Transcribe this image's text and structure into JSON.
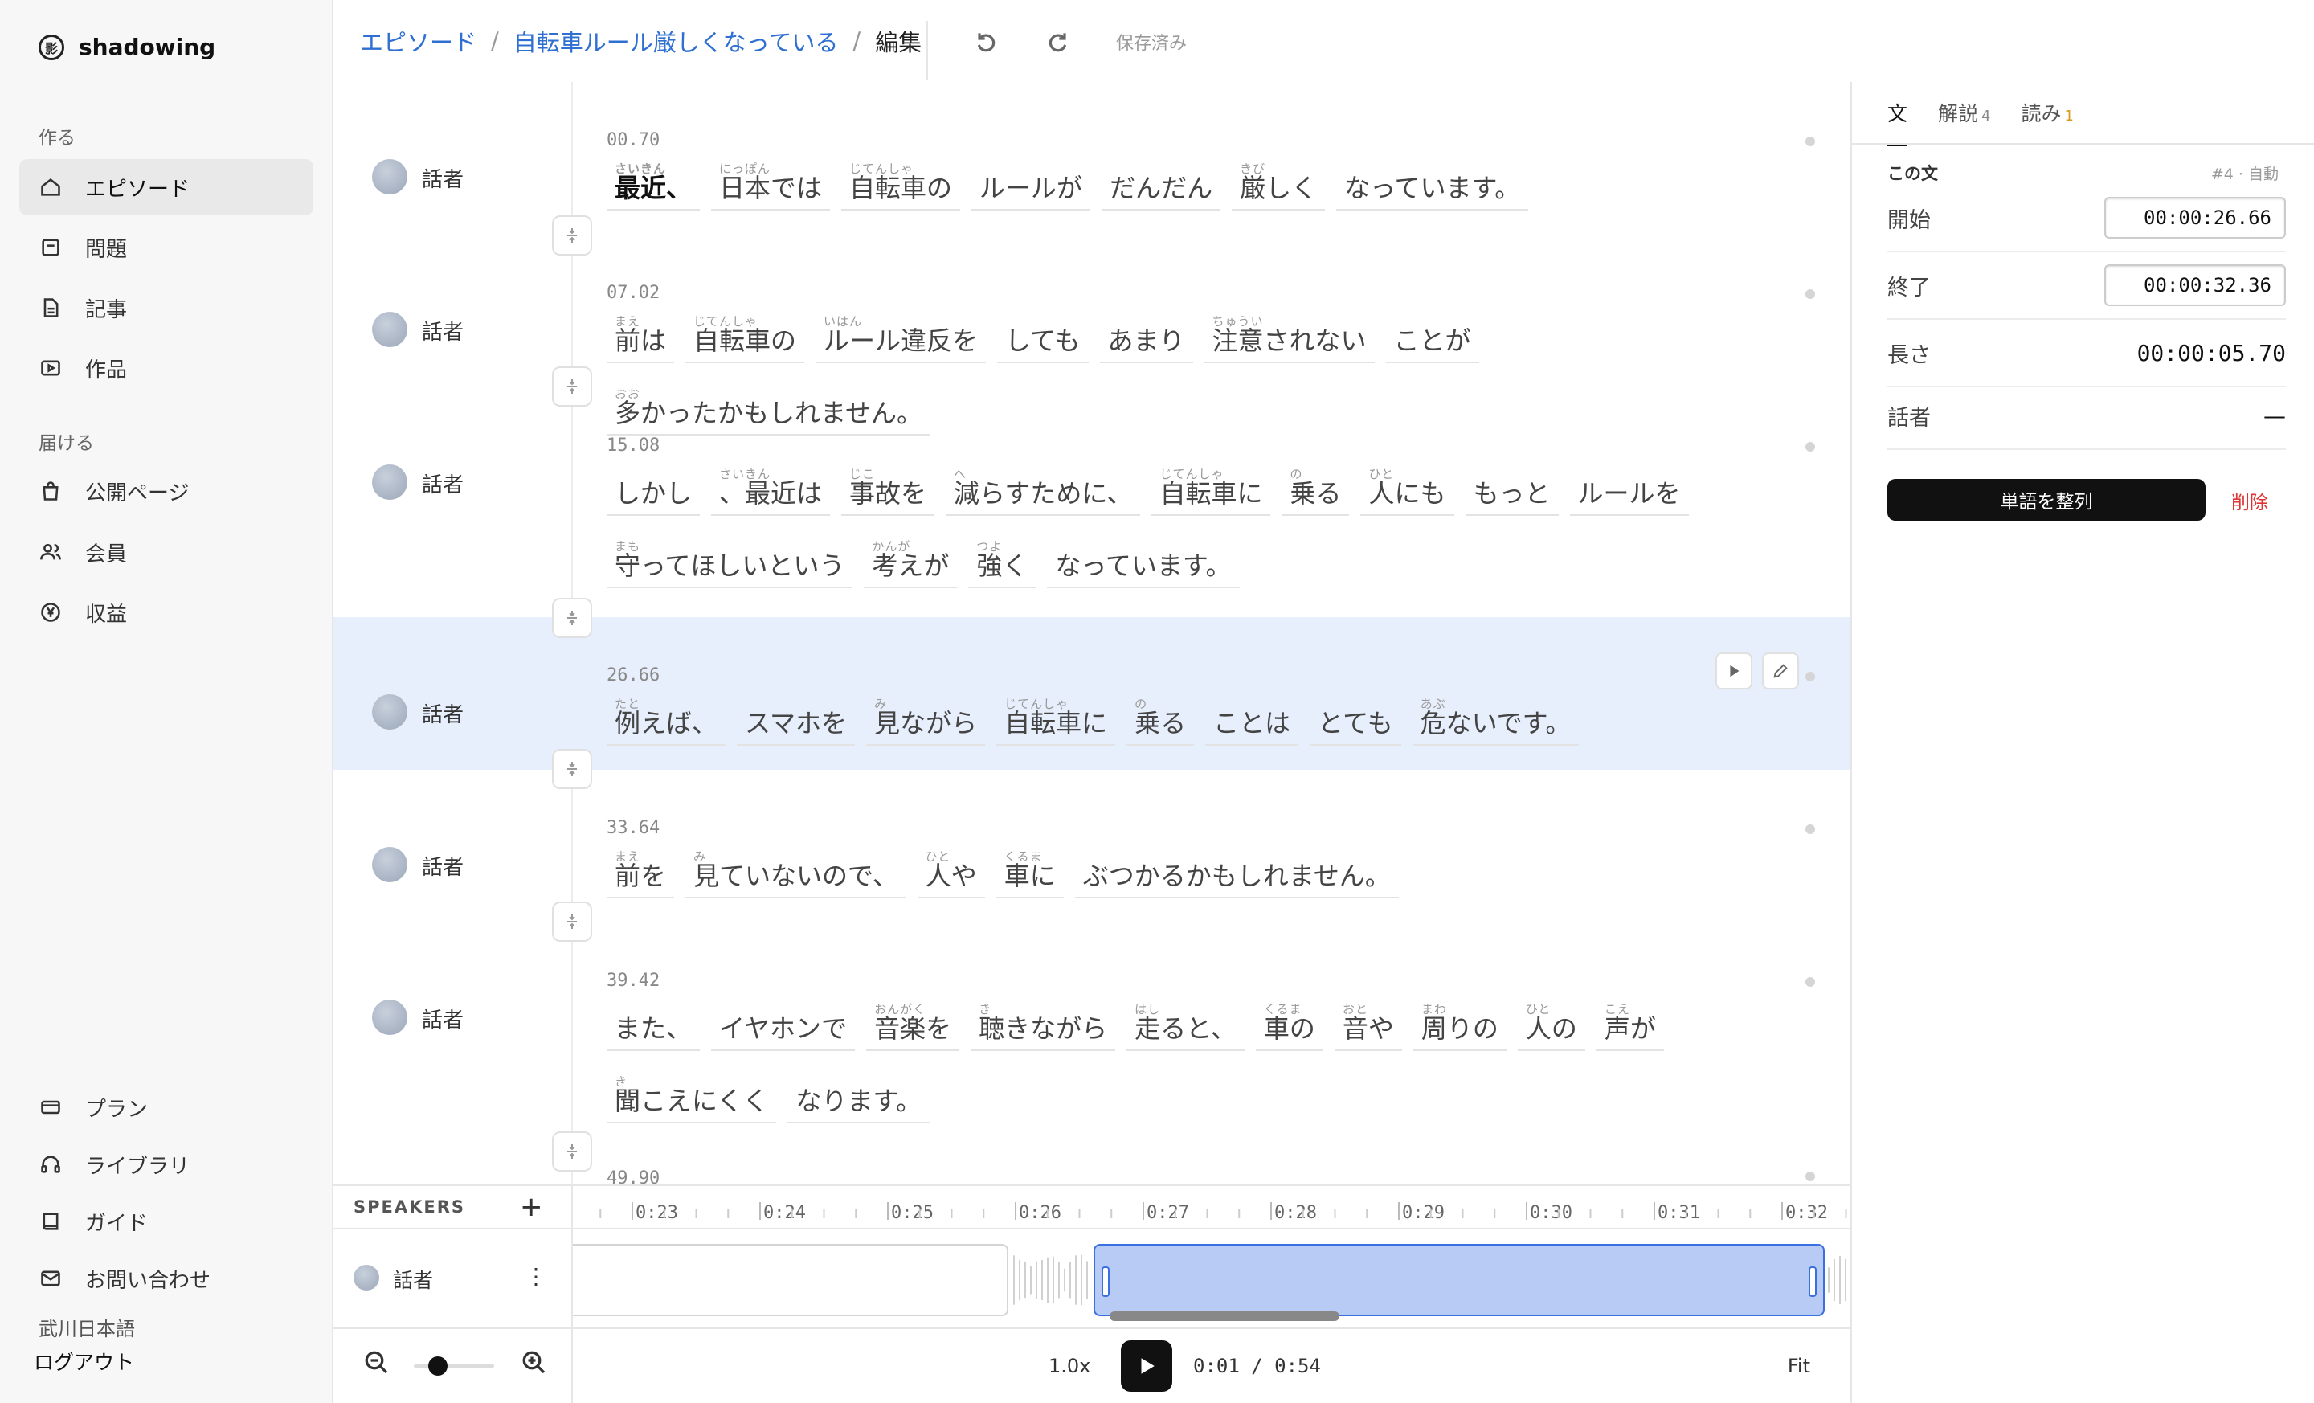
{
  "app": {
    "name": "shadowing",
    "logo_glyph": "影"
  },
  "sidebar": {
    "section_create": "作る",
    "section_deliver": "届ける",
    "create_items": [
      {
        "label": "エピソード",
        "icon": "home-icon"
      },
      {
        "label": "問題",
        "icon": "square-icon"
      },
      {
        "label": "記事",
        "icon": "document-icon"
      },
      {
        "label": "作品",
        "icon": "video-icon"
      }
    ],
    "deliver_items": [
      {
        "label": "公開ページ",
        "icon": "bag-icon"
      },
      {
        "label": "会員",
        "icon": "users-icon"
      },
      {
        "label": "収益",
        "icon": "yen-icon"
      }
    ],
    "bottom_items": [
      {
        "label": "プラン",
        "icon": "card-icon"
      },
      {
        "label": "ライブラリ",
        "icon": "headphones-icon"
      },
      {
        "label": "ガイド",
        "icon": "book-icon"
      },
      {
        "label": "お問い合わせ",
        "icon": "mail-icon"
      }
    ],
    "user_name": "武川日本語",
    "logout": "ログアウト"
  },
  "header": {
    "breadcrumb": {
      "root": "エピソード",
      "episode": "自転車ルール厳しくなっている",
      "current": "編集",
      "sep": "/"
    },
    "save_status": "保存済み"
  },
  "segments": [
    {
      "time": "00.70",
      "speaker": "話者",
      "words": [
        {
          "t": "最近、",
          "r": "さいきん"
        },
        {
          "t": "日本では",
          "r": "にっぽん"
        },
        {
          "t": "自転車の",
          "r": "じてんしゃ"
        },
        {
          "t": "ルールが",
          "r": ""
        },
        {
          "t": "だんだん",
          "r": ""
        },
        {
          "t": "厳しく",
          "r": "きび"
        },
        {
          "t": "なっています。",
          "r": ""
        }
      ]
    },
    {
      "time": "07.02",
      "speaker": "話者",
      "words": [
        {
          "t": "前は",
          "r": "まえ"
        },
        {
          "t": "自転車の",
          "r": "じてんしゃ"
        },
        {
          "t": "ルール違反を",
          "r": "いはん"
        },
        {
          "t": "しても",
          "r": ""
        },
        {
          "t": "あまり",
          "r": ""
        },
        {
          "t": "注意されない",
          "r": "ちゅうい"
        },
        {
          "t": "ことが",
          "r": ""
        },
        {
          "t": "多かったかもしれません。",
          "r": "おお"
        }
      ]
    },
    {
      "time": "15.08",
      "speaker": "話者",
      "words": [
        {
          "t": "しかし",
          "r": ""
        },
        {
          "t": "、最近は",
          "r": "さいきん"
        },
        {
          "t": "事故を",
          "r": "じこ"
        },
        {
          "t": "減らすために、",
          "r": "へ"
        },
        {
          "t": "自転車に",
          "r": "じてんしゃ"
        },
        {
          "t": "乗る",
          "r": "の"
        },
        {
          "t": "人にも",
          "r": "ひと"
        },
        {
          "t": "もっと",
          "r": ""
        },
        {
          "t": "ルールを",
          "r": ""
        },
        {
          "t": "守ってほしいという",
          "r": "まも"
        },
        {
          "t": "考えが",
          "r": "かんが"
        },
        {
          "t": "強く",
          "r": "つよ"
        },
        {
          "t": "なっています。",
          "r": ""
        }
      ]
    },
    {
      "time": "26.66",
      "speaker": "話者",
      "words": [
        {
          "t": "例えば、",
          "r": "たと"
        },
        {
          "t": "スマホを",
          "r": ""
        },
        {
          "t": "見ながら",
          "r": "み"
        },
        {
          "t": "自転車に",
          "r": "じてんしゃ"
        },
        {
          "t": "乗る",
          "r": "の"
        },
        {
          "t": "ことは",
          "r": ""
        },
        {
          "t": "とても",
          "r": ""
        },
        {
          "t": "危ないです。",
          "r": "あぶ"
        }
      ]
    },
    {
      "time": "33.64",
      "speaker": "話者",
      "words": [
        {
          "t": "前を",
          "r": "まえ"
        },
        {
          "t": "見ていないので、",
          "r": "み"
        },
        {
          "t": "人や",
          "r": "ひと"
        },
        {
          "t": "車に",
          "r": "くるま"
        },
        {
          "t": "ぶつかるかもしれません。",
          "r": ""
        }
      ]
    },
    {
      "time": "39.42",
      "speaker": "話者",
      "words": [
        {
          "t": "また、",
          "r": ""
        },
        {
          "t": "イヤホンで",
          "r": ""
        },
        {
          "t": "音楽を",
          "r": "おんがく"
        },
        {
          "t": "聴きながら",
          "r": "き"
        },
        {
          "t": "走ると、",
          "r": "はし"
        },
        {
          "t": "車の",
          "r": "くるま"
        },
        {
          "t": "音や",
          "r": "おと"
        },
        {
          "t": "周りの",
          "r": "まわ"
        },
        {
          "t": "人の",
          "r": "ひと"
        },
        {
          "t": "声が",
          "r": "こえ"
        },
        {
          "t": "聞こえにくく",
          "r": "き"
        },
        {
          "t": "なります。",
          "r": ""
        }
      ]
    },
    {
      "time": "49.90",
      "speaker": "",
      "words": []
    }
  ],
  "selected_segment": 3,
  "panel": {
    "tabs": [
      {
        "label": "文",
        "badge": ""
      },
      {
        "label": "解説",
        "badge": "4"
      },
      {
        "label": "読み",
        "badge": "1"
      }
    ],
    "section_title": "この文",
    "meta": "#4 · 自動",
    "start_label": "開始",
    "start_value": "00:00:26.66",
    "end_label": "終了",
    "end_value": "00:00:32.36",
    "length_label": "長さ",
    "length_value": "00:00:05.70",
    "speaker_label": "話者",
    "speaker_value": "—",
    "align_button": "単語を整列",
    "delete_button": "削除"
  },
  "timeline": {
    "speakers_heading": "SPEAKERS",
    "add": "+",
    "speaker_name": "話者",
    "menu": "⋮",
    "ticks": [
      "0:23",
      "0:24",
      "0:25",
      "0:26",
      "0:27",
      "0:28",
      "0:29",
      "0:30",
      "0:31",
      "0:32"
    ],
    "speed": "1.0x",
    "current_time": "0:01",
    "total_time": "0:54",
    "time_sep": "/",
    "fit": "Fit",
    "zoom_level": 0.3
  },
  "colors": {
    "accent": "#2e6fd1",
    "selection": "#e8effc",
    "clip": "#b7cbf5",
    "danger": "#d33333"
  }
}
